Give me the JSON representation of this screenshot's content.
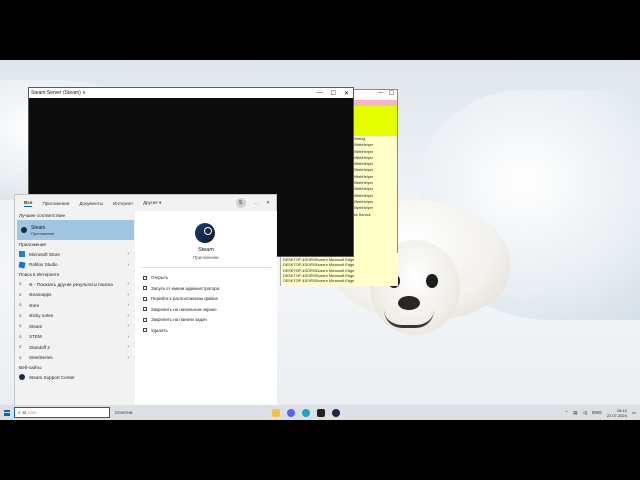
{
  "console": {
    "title": "Steam Server (Steam) ∨",
    "controls": [
      "—",
      "☐",
      "✕"
    ]
  },
  "taskwin": {
    "controls": [
      "—",
      "☐"
    ],
    "rows": [
      "",
      "",
      "",
      "",
      "",
      "",
      "Setting",
      "",
      "\\WebHelper",
      "\\WebHelper",
      "\\WebHelper",
      "\\WebHelper",
      "\\WebHelper",
      "\\WebHelper",
      "\\WebHelper",
      "\\WebHelper",
      "",
      "\\WebHelper",
      "\\WebHelper",
      "\\WebHelper",
      "",
      "",
      "",
      "ke Service"
    ]
  },
  "task_rows": [
    "DESKTOP-4SORV5\\usern   Microsoft Edge",
    "DESKTOP-4SORV5\\usern   Microsoft Edge",
    "DESKTOP-4SORV5\\usern   Microsoft Edge",
    "DESKTOP-4SORV5\\usern   Microsoft Edge",
    "DESKTOP-4SORV5\\usern   Microsoft Edge",
    "DESKTOP-4SORV5\\usern   Microsoft Edge"
  ],
  "search": {
    "tabs": [
      "Все",
      "Приложения",
      "Документы",
      "Интернет",
      "Другие ▾"
    ],
    "avatar_letter": "S",
    "more": "···",
    "close": "✕",
    "best_match_heading": "Лучшее соответствие",
    "best_match": {
      "name": "Steam",
      "type": "Приложение"
    },
    "apps_heading": "Приложения",
    "apps": [
      "Microsoft Store",
      "Roblox Studio"
    ],
    "web_heading": "Поиск в Интернете",
    "web_items": [
      "st - Показать другие результаты поиска",
      "steamapps",
      "store",
      "sticky notes",
      "Steam",
      "STEM",
      "Standoff 2",
      "SteelSeries"
    ],
    "sites_heading": "Веб-сайты",
    "sites": [
      "Steam Support Center"
    ],
    "detail": {
      "title": "Steam",
      "subtitle": "Приложение",
      "actions": [
        "Открыть",
        "Запуск от имени администратора",
        "Перейти к расположению файла",
        "Закрепить на начальном экране",
        "Закрепить на панели задач",
        "Удалить"
      ]
    }
  },
  "taskbar": {
    "search_typed": "st",
    "search_placeholder": "eam",
    "search_label": "Сплетни",
    "lang": "ENG",
    "time": "19:12",
    "date": "22.07.2024",
    "accent": "#0067c0"
  }
}
